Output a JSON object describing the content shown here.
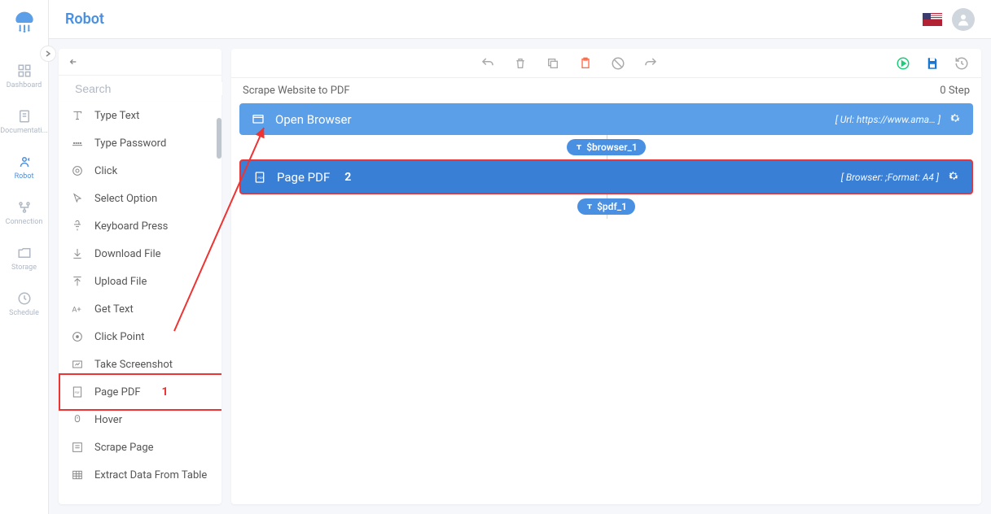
{
  "header": {
    "title": "Robot"
  },
  "nav": {
    "items": [
      {
        "label": "Dashboard"
      },
      {
        "label": "Documentati..."
      },
      {
        "label": "Robot"
      },
      {
        "label": "Connection"
      },
      {
        "label": "Storage"
      },
      {
        "label": "Schedule"
      }
    ]
  },
  "palette": {
    "search_placeholder": "Search",
    "actions": [
      {
        "label": "Type Text",
        "icon": "type"
      },
      {
        "label": "Type Password",
        "icon": "password"
      },
      {
        "label": "Click",
        "icon": "click"
      },
      {
        "label": "Select Option",
        "icon": "select"
      },
      {
        "label": "Keyboard Press",
        "icon": "keyboard"
      },
      {
        "label": "Download File",
        "icon": "download"
      },
      {
        "label": "Upload File",
        "icon": "upload"
      },
      {
        "label": "Get Text",
        "icon": "gettext"
      },
      {
        "label": "Click Point",
        "icon": "clickpoint"
      },
      {
        "label": "Take Screenshot",
        "icon": "screenshot"
      },
      {
        "label": "Page PDF",
        "icon": "pdf"
      },
      {
        "label": "Hover",
        "icon": "hover"
      },
      {
        "label": "Scrape Page",
        "icon": "scrape"
      },
      {
        "label": "Extract Data From Table",
        "icon": "table"
      }
    ]
  },
  "canvas": {
    "title": "Scrape Website to PDF",
    "step_count": "0 Step",
    "steps": [
      {
        "title": "Open Browser",
        "params": "[  Url: https://www.ama…  ]",
        "output": "$browser_1"
      },
      {
        "title": "Page PDF",
        "params": "[  Browser:  ;Format: A4  ]",
        "output": "$pdf_1"
      }
    ]
  },
  "annotations": {
    "one": "1",
    "two": "2"
  }
}
